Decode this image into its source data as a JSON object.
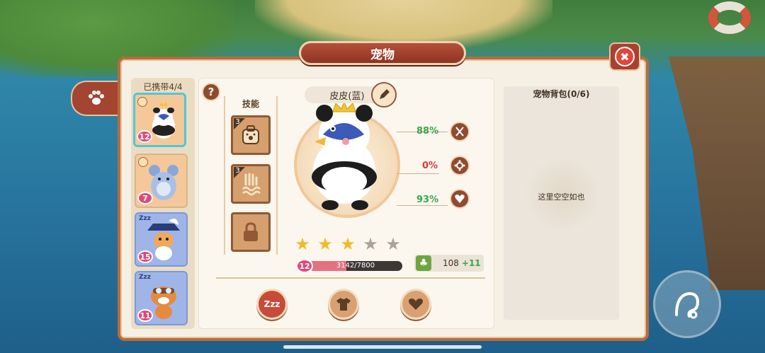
{
  "header": {
    "title": "宠物"
  },
  "roster": {
    "title": "已携带4/4",
    "pets": [
      {
        "name": "penguin-panda",
        "level": "12",
        "sleeping": false,
        "selected": true
      },
      {
        "name": "blue-chinchilla",
        "level": "7",
        "sleeping": false,
        "selected": false
      },
      {
        "name": "pirate-cat",
        "level": "15",
        "sleeping": true,
        "selected": false
      },
      {
        "name": "pilot-cat",
        "level": "11",
        "sleeping": true,
        "selected": false
      }
    ],
    "zzz": "Zzz"
  },
  "help": {
    "label": "?"
  },
  "skills": {
    "label": "技能",
    "slots": [
      {
        "count": "3",
        "icon": "paw-bag-icon"
      },
      {
        "count": "3",
        "icon": "water-hand-icon"
      },
      {
        "count": "",
        "icon": "lock-icon"
      }
    ]
  },
  "pet": {
    "name": "皮皮(蓝)",
    "stats": [
      {
        "value": "88%",
        "icon": "food-icon",
        "color": "#3aa64a"
      },
      {
        "value": "0%",
        "icon": "clean-icon",
        "color": "#d63a3a"
      },
      {
        "value": "93%",
        "icon": "heart-icon",
        "color": "#3aa64a"
      }
    ],
    "stars": {
      "filled": 3,
      "total": 5
    },
    "level": "12",
    "xp": {
      "current": 3142,
      "max": 7800,
      "text": "3142/7800"
    },
    "clover": {
      "value": "108",
      "bonus": "+11"
    }
  },
  "actions": [
    {
      "name": "sleep-button",
      "icon": "Zzz"
    },
    {
      "name": "outfit-button",
      "icon": "shirt"
    },
    {
      "name": "affection-button",
      "icon": "heart"
    }
  ],
  "bag": {
    "title": "宠物背包(0/6)",
    "empty": "这里空空如也"
  },
  "colors": {
    "accent": "#a34530",
    "panel": "#f6efe3",
    "xp": "#e57080"
  }
}
